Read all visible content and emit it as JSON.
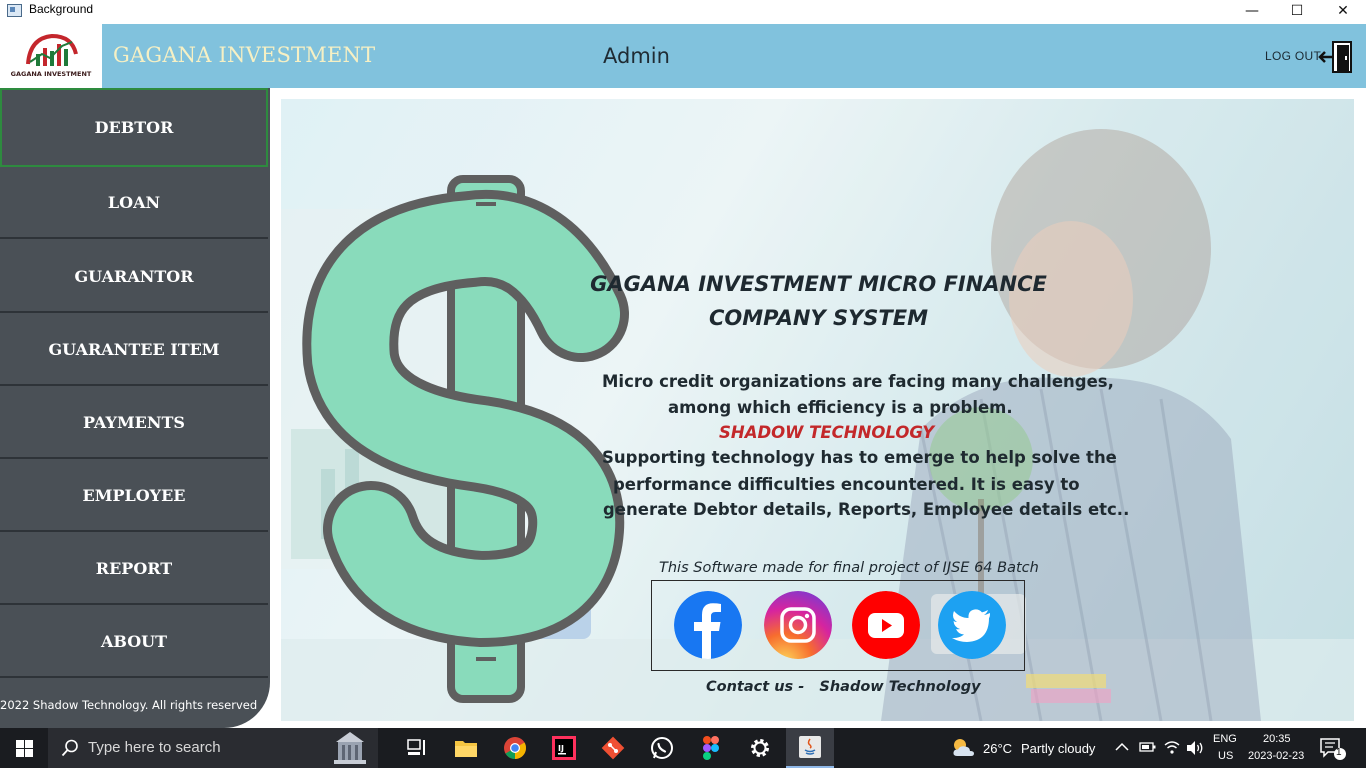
{
  "window": {
    "title": "Background",
    "minimize_glyph": "—",
    "maximize_glyph": "☐",
    "close_glyph": "✕"
  },
  "header": {
    "logo_caption": "GAGANA INVESTMENT",
    "brand": "GAGANA INVESTMENT",
    "user": "Admin",
    "logout_label": "LOG OUT"
  },
  "sidebar": {
    "items": [
      {
        "label": "DEBTOR"
      },
      {
        "label": "LOAN"
      },
      {
        "label": "GUARANTOR"
      },
      {
        "label": "GUARANTEE ITEM"
      },
      {
        "label": "PAYMENTS"
      },
      {
        "label": "EMPLOYEE"
      },
      {
        "label": "REPORT"
      },
      {
        "label": "ABOUT"
      }
    ],
    "copyright": "2022 Shadow Technology. All rights  reserved"
  },
  "main": {
    "headline_line1": "GAGANA INVESTMENT MICRO FINANCE",
    "headline_line2": "COMPANY SYSTEM",
    "para1_line1": "Micro credit organizations are facing many challenges,",
    "para1_line2": "among which efficiency is a problem.",
    "shadow_label": "SHADOW TECHNOLOGY",
    "para2_line1": "Supporting technology has to emerge to help solve the",
    "para2_line2": "performance difficulties encountered. It is easy to",
    "para2_line3": "generate Debtor details, Reports, Employee details etc..",
    "made_for": "This Software made for final project of IJSE 64 Batch",
    "contact_prefix": "Contact us -",
    "contact_name": "Shadow Technology"
  },
  "taskbar": {
    "search_placeholder": "Type here to search",
    "weather_temp": "26°C",
    "weather_desc": "Partly cloudy",
    "lang_line1": "ENG",
    "lang_line2": "US",
    "time": "20:35",
    "date": "2023-02-23",
    "notification_count": "1"
  },
  "colors": {
    "header_bg": "#81c2dd",
    "sidebar_bg": "#4a5056",
    "active_border": "#2e8b3f",
    "accent_red": "#c3282a",
    "dollar_green": "#6fd3ad"
  }
}
